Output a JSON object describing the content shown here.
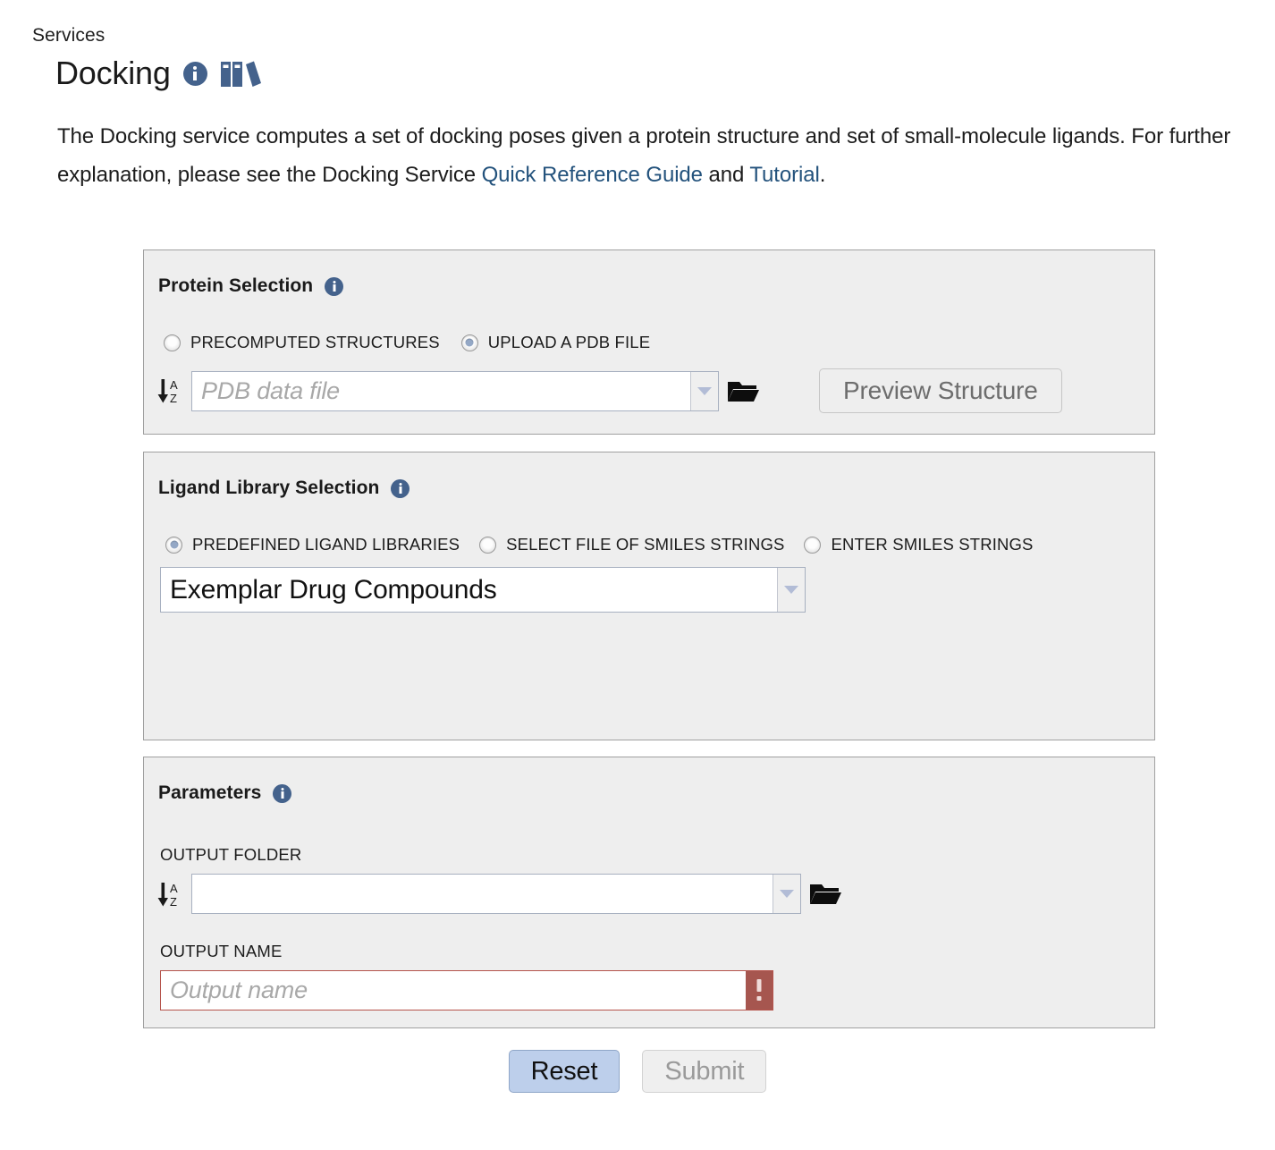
{
  "header": {
    "breadcrumb": "Services",
    "title": "Docking",
    "info_icon": "info-icon",
    "docs_icon": "books-icon"
  },
  "description": {
    "part1": "The Docking service computes a set of docking poses given a protein structure and set of small-molecule ligands. For further explanation, please see the Docking Service ",
    "link1": "Quick Reference Guide",
    "part2": " and ",
    "link2": "Tutorial",
    "part3": ".",
    "link_color": "#23527c"
  },
  "protein_selection": {
    "title": "Protein Selection",
    "options": [
      {
        "label": "PRECOMPUTED STRUCTURES",
        "selected": false
      },
      {
        "label": "UPLOAD A PDB FILE",
        "selected": true
      }
    ],
    "file_input": {
      "value": "",
      "placeholder": "PDB data file",
      "sort_icon": "sort-az-icon",
      "dropdown_icon": "chevron-down-icon",
      "browse_icon": "folder-open-icon"
    },
    "preview_button": {
      "label": "Preview Structure",
      "disabled": true
    }
  },
  "ligand_library_selection": {
    "title": "Ligand Library Selection",
    "options": [
      {
        "label": "PREDEFINED LIGAND LIBRARIES",
        "selected": true
      },
      {
        "label": "SELECT FILE OF SMILES STRINGS",
        "selected": false
      },
      {
        "label": "ENTER SMILES STRINGS",
        "selected": false
      }
    ],
    "library_select": {
      "value": "Exemplar Drug Compounds",
      "dropdown_icon": "chevron-down-icon"
    }
  },
  "parameters": {
    "title": "Parameters",
    "output_folder": {
      "label": "OUTPUT FOLDER",
      "value": "",
      "placeholder": "",
      "sort_icon": "sort-az-icon",
      "dropdown_icon": "chevron-down-icon",
      "browse_icon": "folder-open-icon"
    },
    "output_name": {
      "label": "OUTPUT NAME",
      "value": "",
      "placeholder": "Output name",
      "error": true,
      "error_icon": "exclamation-icon",
      "error_color": "#a6564f"
    }
  },
  "footer": {
    "reset_label": "Reset",
    "submit_label": "Submit",
    "submit_disabled": true,
    "reset_color": "#bdcfeb"
  }
}
